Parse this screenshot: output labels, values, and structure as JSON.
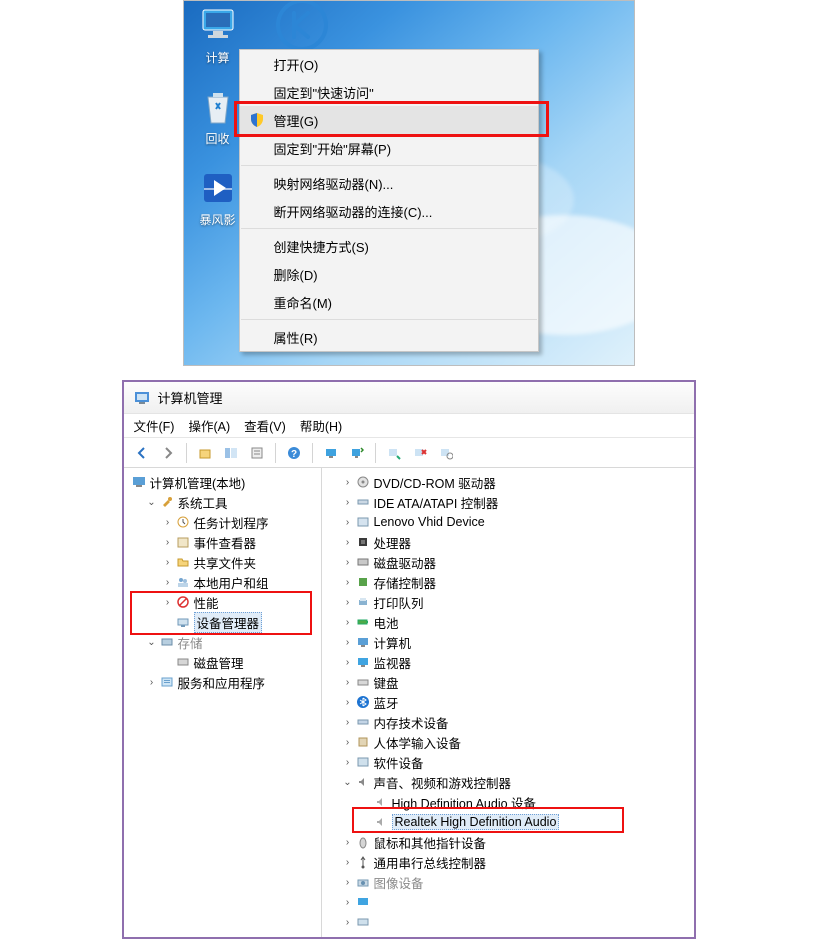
{
  "fig1": {
    "desktop_icons": [
      {
        "name": "computer-icon",
        "label": "计算"
      },
      {
        "name": "recycle-bin-icon",
        "label": "回收"
      },
      {
        "name": "baofeng-icon",
        "label": "暴风影"
      }
    ],
    "context_menu": {
      "open": "打开(O)",
      "pin_quick": "固定到\"快速访问\"",
      "manage": "管理(G)",
      "pin_start": "固定到\"开始\"屏幕(P)",
      "map_drive": "映射网络驱动器(N)...",
      "disconnect": "断开网络驱动器的连接(C)...",
      "shortcut": "创建快捷方式(S)",
      "delete": "删除(D)",
      "rename": "重命名(M)",
      "properties": "属性(R)"
    }
  },
  "fig2": {
    "title": "计算机管理",
    "menus": {
      "file": "文件(F)",
      "action": "操作(A)",
      "view": "查看(V)",
      "help": "帮助(H)"
    },
    "left": {
      "root": "计算机管理(本地)",
      "systools": "系统工具",
      "task": "任务计划程序",
      "event": "事件查看器",
      "shared": "共享文件夹",
      "users": "本地用户和组",
      "perf": "性能",
      "devmgr": "设备管理器",
      "storage": "存储",
      "diskmgmt": "磁盘管理",
      "services": "服务和应用程序"
    },
    "right": {
      "dvd": "DVD/CD-ROM 驱动器",
      "ide": "IDE ATA/ATAPI 控制器",
      "lenovo": "Lenovo Vhid Device",
      "cpu": "处理器",
      "disk": "磁盘驱动器",
      "storctrl": "存储控制器",
      "printq": "打印队列",
      "battery": "电池",
      "computer": "计算机",
      "monitor": "监视器",
      "keyboard": "键盘",
      "bluetooth": "蓝牙",
      "memory": "内存技术设备",
      "hid": "人体学输入设备",
      "softdev": "软件设备",
      "sound": "声音、视频和游戏控制器",
      "hda": "High Definition Audio 设备",
      "realtek": "Realtek High Definition Audio",
      "mouse": "鼠标和其他指针设备",
      "usb": "通用串行总线控制器",
      "imgdev": "图像设备"
    }
  }
}
